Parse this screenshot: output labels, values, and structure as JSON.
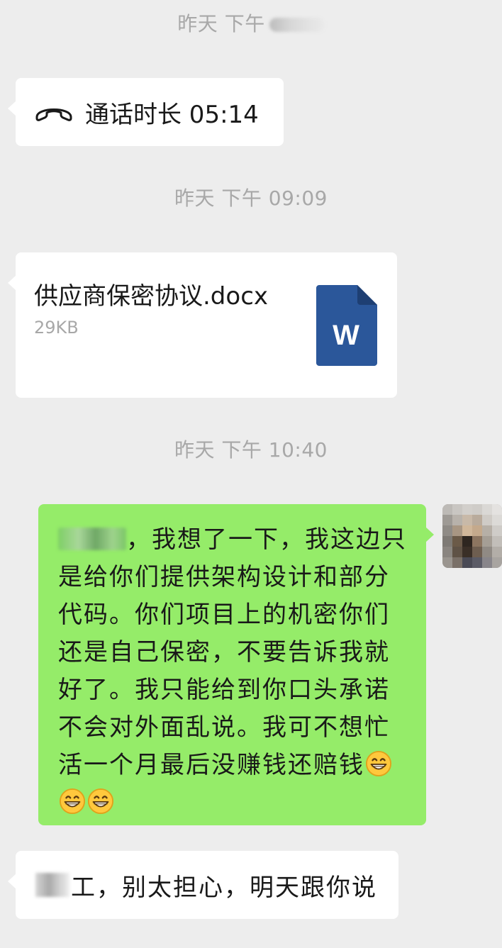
{
  "timestamps": {
    "first": "昨天 下午",
    "second": "昨天 下午 09:09",
    "third": "昨天 下午 10:40"
  },
  "call": {
    "icon": "phone-hangup-icon",
    "text": "通话时长 05:14"
  },
  "file": {
    "name": "供应商保密协议.docx",
    "size": "29KB",
    "icon": "word-document-icon",
    "icon_letter": "W",
    "icon_color": "#2B579A"
  },
  "message_sent": {
    "text_after_name": "，我想了一下，我这边只是给你们提供架构设计和部分代码。你们项目上的机密你们还是自己保密，不要告诉我就好了。我只能给到你口头承诺不会对外面乱说。我可不想忙活一个月最后没赚钱还赔钱",
    "emoji_icon": "grinning-face-icon",
    "bubble_color": "#95EC69"
  },
  "message_received": {
    "text": "工，别太担心，明天跟你说"
  },
  "colors": {
    "background": "#EDEDED",
    "bubble_white": "#FFFFFF",
    "text": "#191919",
    "meta": "#A8A8A8"
  }
}
